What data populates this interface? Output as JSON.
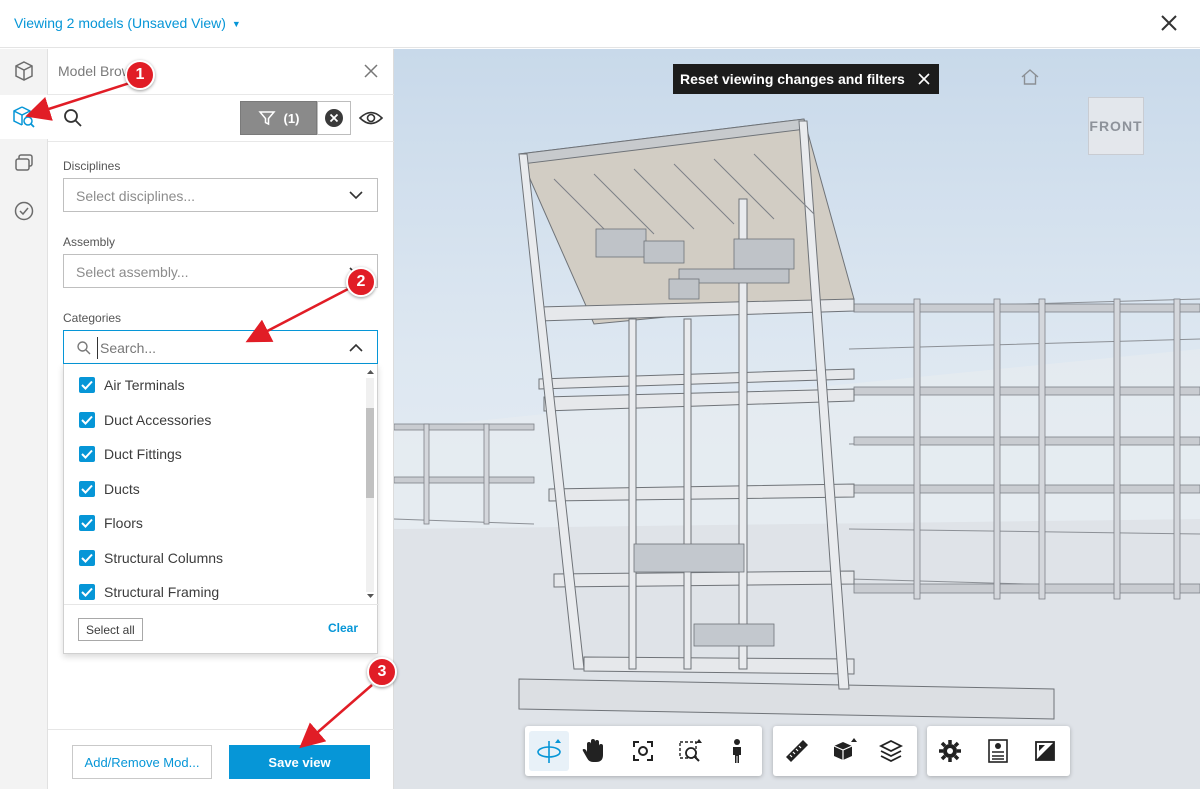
{
  "header": {
    "view_title": "Viewing 2 models (Unsaved View)"
  },
  "panel": {
    "title": "Model Browser",
    "filter_count": "(1)",
    "disciplines": {
      "label": "Disciplines",
      "placeholder": "Select disciplines..."
    },
    "assembly": {
      "label": "Assembly",
      "placeholder": "Select assembly..."
    },
    "categories": {
      "label": "Categories",
      "search_placeholder": "Search...",
      "items": [
        {
          "label": "Air Terminals",
          "checked": true
        },
        {
          "label": "Duct Accessories",
          "checked": true
        },
        {
          "label": "Duct Fittings",
          "checked": true
        },
        {
          "label": "Ducts",
          "checked": true
        },
        {
          "label": "Floors",
          "checked": true
        },
        {
          "label": "Structural Columns",
          "checked": true
        },
        {
          "label": "Structural Framing",
          "checked": true
        }
      ],
      "select_all_label": "Select all",
      "clear_label": "Clear"
    },
    "add_remove_label": "Add/Remove Mod...",
    "save_label": "Save view"
  },
  "viewer": {
    "reset_tooltip": "Reset viewing changes and filters",
    "viewcube_label": "FRONT"
  },
  "annotations": {
    "step1": "1",
    "step2": "2",
    "step3": "3"
  },
  "colors": {
    "accent": "#0696d7",
    "annotation": "#e11d26",
    "filter_active": "#8a8a8a"
  },
  "icons": {
    "rail": [
      "cube-icon",
      "model-browser-icon",
      "sheets-icon",
      "check-circle-icon"
    ],
    "toolbar": [
      "orbit-icon",
      "pan-icon",
      "fit-view-icon",
      "zoom-window-icon",
      "first-person-icon",
      "measure-icon",
      "section-box-icon",
      "layers-icon",
      "settings-icon",
      "properties-icon",
      "fullscreen-icon"
    ]
  }
}
